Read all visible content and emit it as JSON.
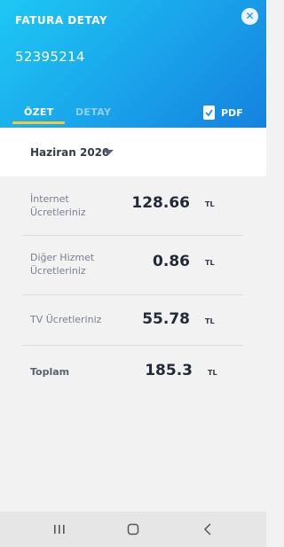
{
  "header": {
    "title": "FATURA DETAY",
    "account_number": "52395214",
    "close_label": "✕",
    "tabs": [
      {
        "label": "ÖZET",
        "active": true
      },
      {
        "label": "DETAY",
        "active": false
      }
    ],
    "pdf_label": "PDF"
  },
  "period": {
    "label": "Haziran 2020"
  },
  "charges": [
    {
      "label": "İnternet\nÜcretleriniz",
      "value": "128.66",
      "unit": "TL"
    },
    {
      "label": "Diğer Hizmet\nÜcretleriniz",
      "value": "0.86",
      "unit": "TL"
    },
    {
      "label": "TV Ücretleriniz",
      "value": "55.78",
      "unit": "TL"
    }
  ],
  "total": {
    "label": "Toplam",
    "value": "185.3",
    "unit": "TL"
  },
  "colors": {
    "header_gradient_start": "#1ec8f4",
    "header_gradient_end": "#1582e0",
    "tab_underline": "#f6c832"
  }
}
